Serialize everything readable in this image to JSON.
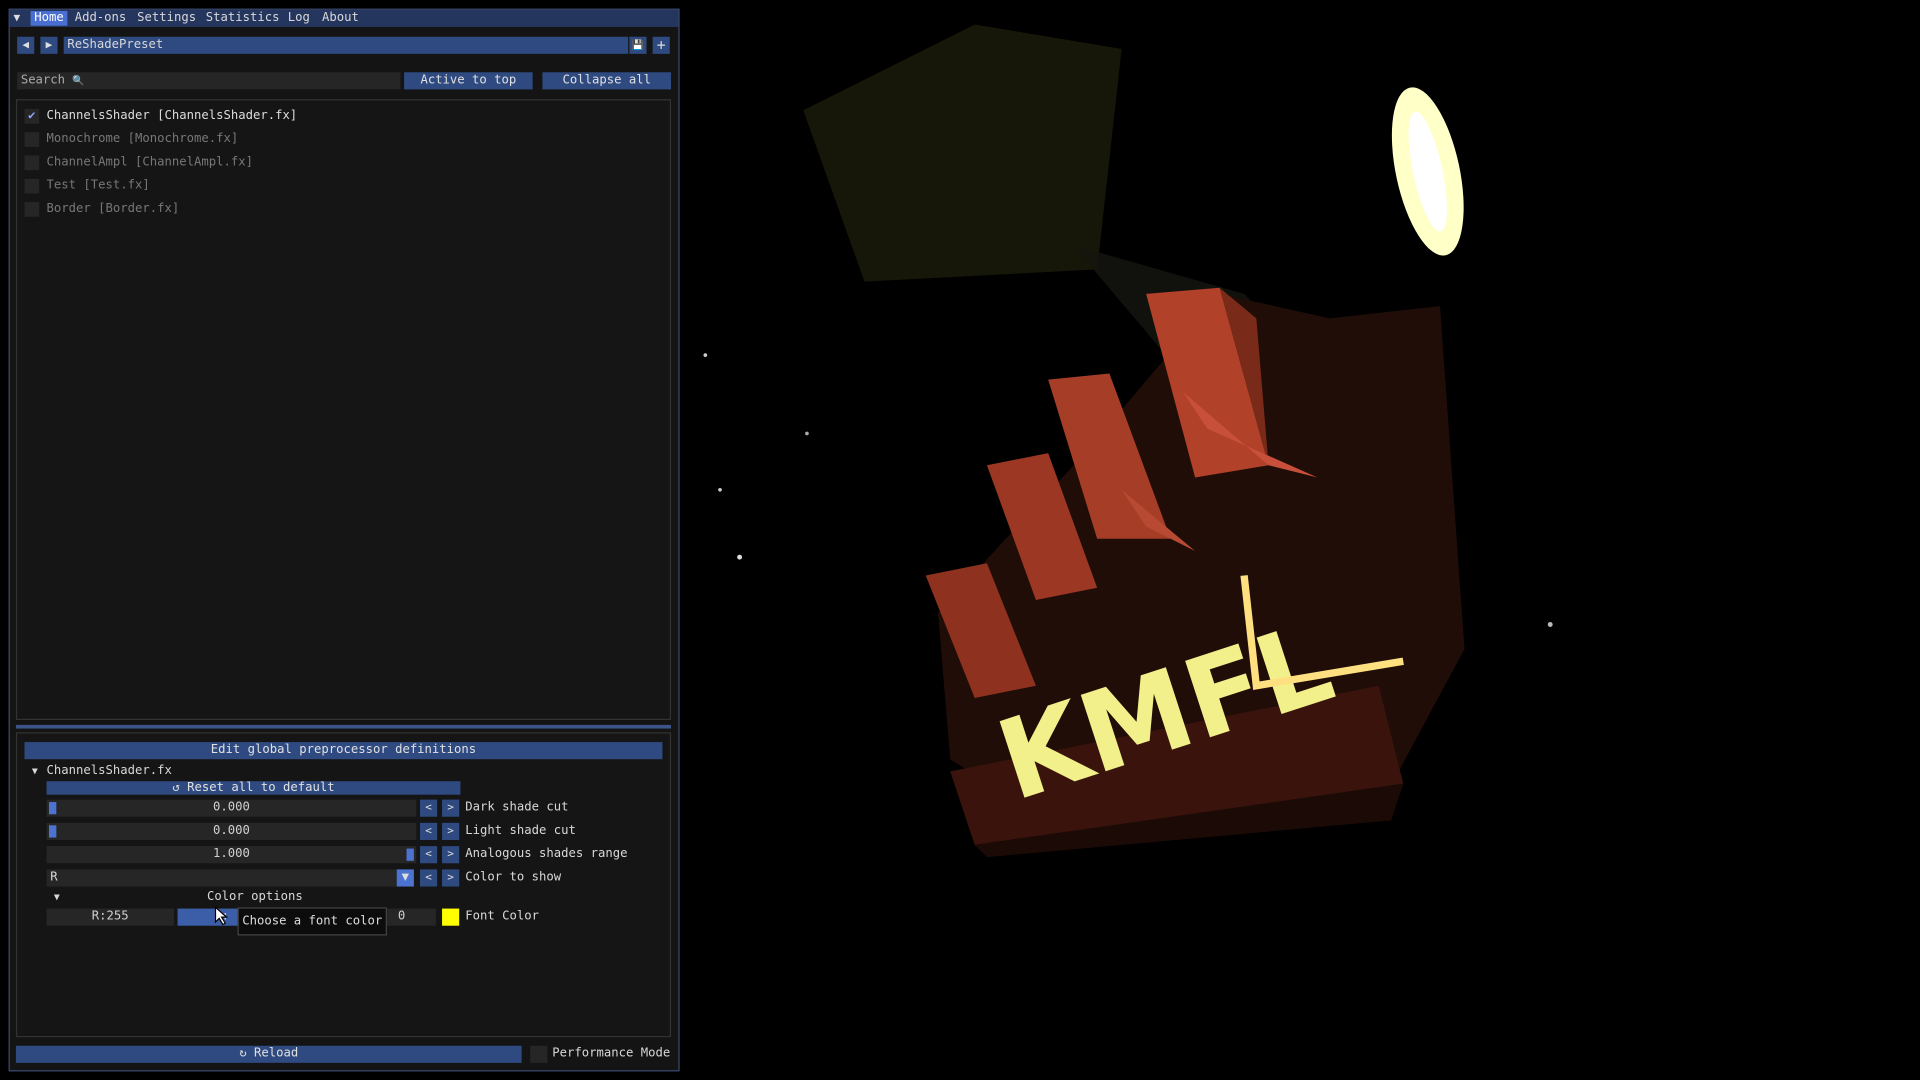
{
  "menu": {
    "collapse_icon": "▼",
    "items": [
      "Home",
      "Add-ons",
      "Settings",
      "Statistics",
      "Log",
      "About"
    ],
    "active": "Home"
  },
  "preset": {
    "name": "ReShadePreset",
    "prev_icon": "◀",
    "next_icon": "▶",
    "save_icon": "💾",
    "add_icon": "+"
  },
  "search": {
    "placeholder": "Search",
    "search_icon": "🔍"
  },
  "buttons": {
    "active_to_top": "Active to top",
    "collapse_all": "Collapse all"
  },
  "effects": [
    {
      "label": "ChannelsShader [ChannelsShader.fx]",
      "enabled": true
    },
    {
      "label": "Monochrome [Monochrome.fx]",
      "enabled": false
    },
    {
      "label": "ChannelAmpl [ChannelAmpl.fx]",
      "enabled": false
    },
    {
      "label": "Test [Test.fx]",
      "enabled": false
    },
    {
      "label": "Border [Border.fx]",
      "enabled": false
    }
  ],
  "params": {
    "edit_global": "Edit global preprocessor definitions",
    "file": "ChannelsShader.fx",
    "expand_icon": "▼",
    "reset_label": "Reset all to default",
    "reset_icon": "↺",
    "dark": {
      "value": "0.000",
      "label": "Dark shade cut",
      "level": 0
    },
    "light": {
      "value": "0.000",
      "label": "Light shade cut",
      "level": 0
    },
    "analog": {
      "value": "1.000",
      "label": "Analogous shades range",
      "level": 1
    },
    "color_show": {
      "value": "R",
      "label": "Color to show"
    },
    "color_options": "Color options",
    "font_color": {
      "r": "R:255",
      "g_partial": "G:",
      "b_partial": "0",
      "label": "Font Color",
      "swatch": "#ffff00"
    },
    "step_left": "<",
    "step_right": ">",
    "tooltip": "Choose a font color"
  },
  "footer": {
    "reload": "Reload",
    "reload_icon": "↻",
    "performance": "Performance Mode"
  },
  "colors": {
    "accent": "#4a6fd0",
    "button": "#2e4a80",
    "frame": "#262626",
    "bg": "#141414"
  }
}
